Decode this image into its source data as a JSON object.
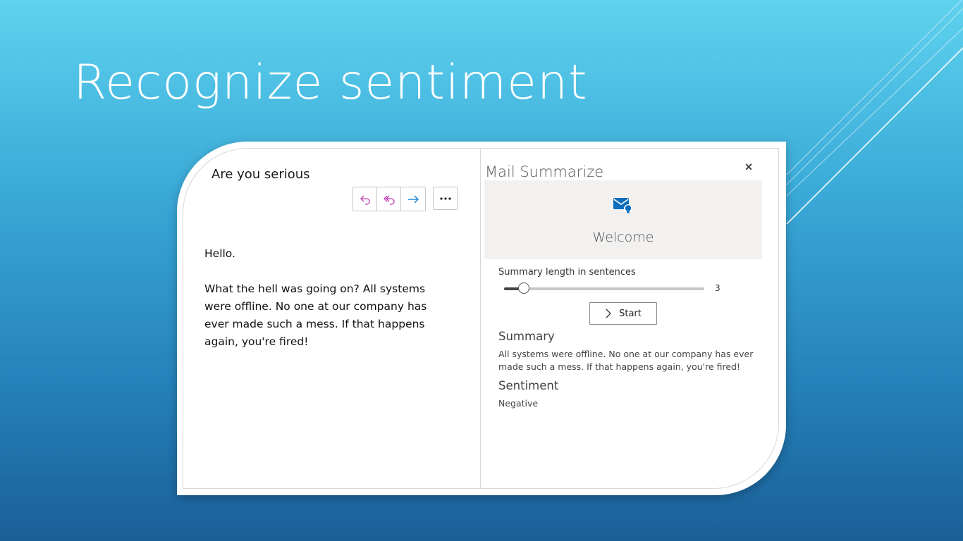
{
  "slide": {
    "title": "Recognize sentiment"
  },
  "mail": {
    "subject": "Are you serious",
    "actions": [
      {
        "name": "reply",
        "icon": "reply-icon",
        "color": "#c239b3"
      },
      {
        "name": "reply-all",
        "icon": "reply-all-icon",
        "color": "#c239b3"
      },
      {
        "name": "forward",
        "icon": "forward-icon",
        "color": "#0078d4"
      }
    ],
    "more_icon": "more-options-icon",
    "body": [
      "Hello.",
      "What the hell was going on? All systems were offline. No one at our company has ever made such a mess. If that happens again, you're fired!"
    ]
  },
  "addin": {
    "title": "Mail Summarize",
    "close_label": "×",
    "welcome_icon": "mail-lightbulb-icon",
    "welcome_text": "Welcome",
    "slider_label": "Summary length in sentences",
    "slider_value": "3",
    "slider_fraction": 0.1,
    "start_label": "Start",
    "summary_heading": "Summary",
    "summary_text": "All systems were offline. No one at our company has ever made such a mess. If that happens again, you're fired!",
    "sentiment_heading": "Sentiment",
    "sentiment_text": "Negative"
  },
  "colors": {
    "accent_blue": "#0f6cbd",
    "reply_purple": "#c239b3"
  }
}
